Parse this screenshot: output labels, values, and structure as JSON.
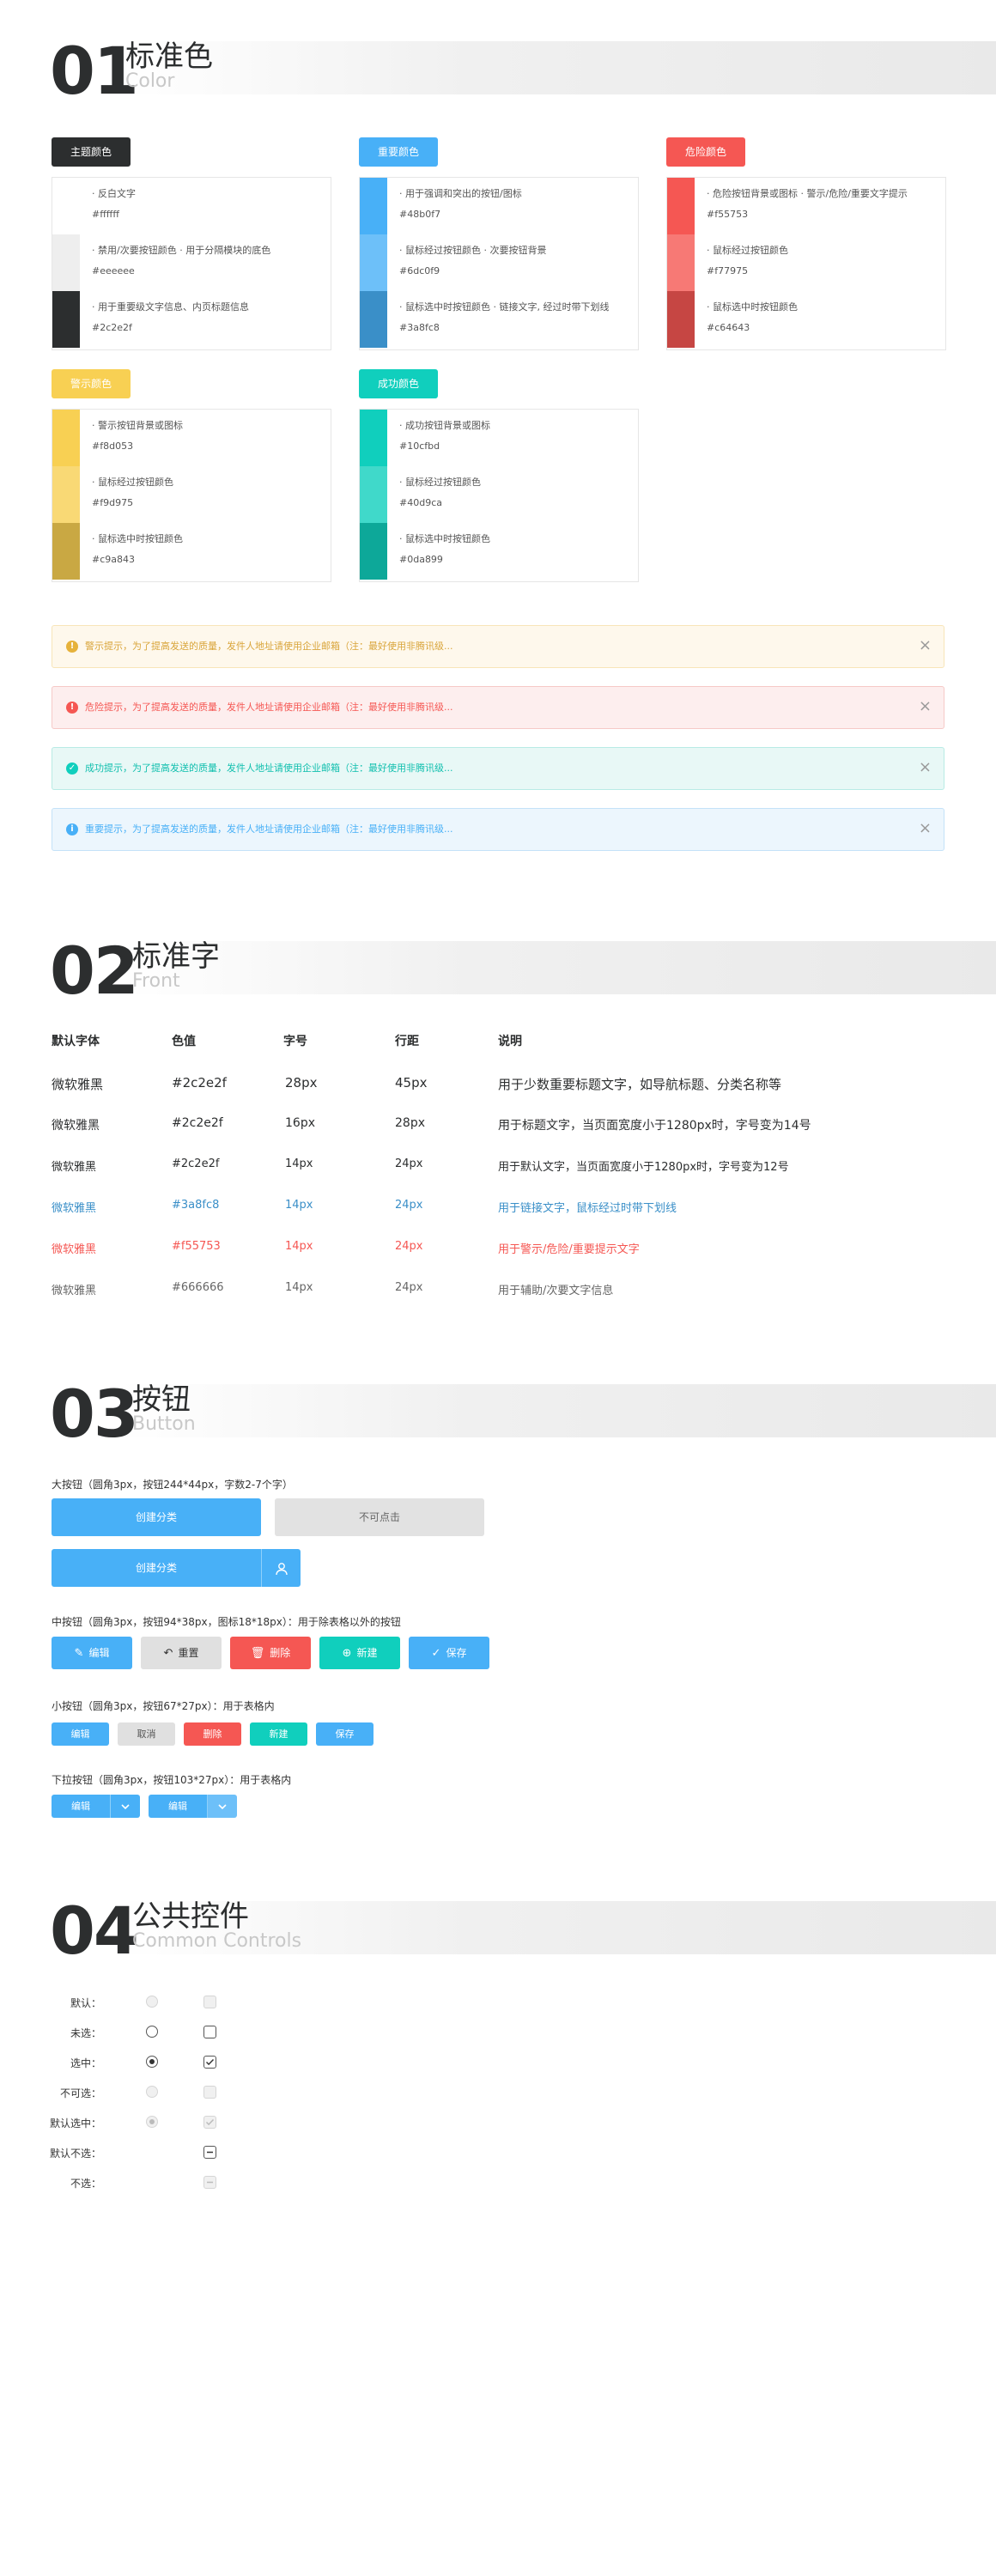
{
  "colors": {
    "accent": "#2c2e2f",
    "primary": "#48b0f7",
    "danger": "#f55753",
    "warning": "#f8d053",
    "success": "#10cfbd"
  },
  "section1": {
    "num": "01",
    "title": "标准色",
    "subtitle": "Color"
  },
  "swatches": [
    {
      "label": "主题颜色",
      "labelColor": "#2c2e2f",
      "rows": [
        {
          "color": "#ffffff",
          "desc": "· 反白文字",
          "hex": "#ffffff"
        },
        {
          "color": "#eeeeee",
          "desc": "· 禁用/次要按钮颜色 · 用于分隔模块的底色",
          "hex": "#eeeeee"
        },
        {
          "color": "#2c2e2f",
          "desc": "· 用于重要级文字信息、内页标题信息",
          "hex": "#2c2e2f"
        }
      ]
    },
    {
      "label": "重要颜色",
      "labelColor": "#48b0f7",
      "rows": [
        {
          "color": "#48b0f7",
          "desc": "· 用于强调和突出的按钮/图标",
          "hex": "#48b0f7"
        },
        {
          "color": "#6dc0f9",
          "desc": "· 鼠标经过按钮颜色 · 次要按钮背景",
          "hex": "#6dc0f9"
        },
        {
          "color": "#3a8fc8",
          "desc": "· 鼠标选中时按钮颜色 · 链接文字, 经过时带下划线",
          "hex": "#3a8fc8"
        }
      ]
    },
    {
      "label": "危险颜色",
      "labelColor": "#f55753",
      "rows": [
        {
          "color": "#f55753",
          "desc": "· 危险按钮背景或图标 · 警示/危险/重要文字提示",
          "hex": "#f55753"
        },
        {
          "color": "#f77975",
          "desc": "· 鼠标经过按钮颜色",
          "hex": "#f77975"
        },
        {
          "color": "#c64643",
          "desc": "· 鼠标选中时按钮颜色",
          "hex": "#c64643"
        }
      ]
    },
    {
      "label": "警示颜色",
      "labelColor": "#f8d053",
      "rows": [
        {
          "color": "#f8d053",
          "desc": "· 警示按钮背景或图标",
          "hex": "#f8d053"
        },
        {
          "color": "#f9d975",
          "desc": "· 鼠标经过按钮颜色",
          "hex": "#f9d975"
        },
        {
          "color": "#c9a843",
          "desc": "· 鼠标选中时按钮颜色",
          "hex": "#c9a843"
        }
      ]
    },
    {
      "label": "成功颜色",
      "labelColor": "#10cfbd",
      "rows": [
        {
          "color": "#10cfbd",
          "desc": "· 成功按钮背景或图标",
          "hex": "#10cfbd"
        },
        {
          "color": "#40d9ca",
          "desc": "· 鼠标经过按钮颜色",
          "hex": "#40d9ca"
        },
        {
          "color": "#0da899",
          "desc": "· 鼠标选中时按钮颜色",
          "hex": "#0da899"
        }
      ]
    }
  ],
  "alerts": [
    {
      "text": "警示提示，为了提高发送的质量，发件人地址请使用企业邮箱（注：最好使用非腾讯级...",
      "icon": "!",
      "close": "×",
      "bg": "#fef8ec",
      "border": "#f8e5b8",
      "color": "#d9a53a",
      "iconBg": "#e6b23b"
    },
    {
      "text": "危险提示，为了提高发送的质量，发件人地址请使用企业邮箱（注：最好使用非腾讯级...",
      "icon": "!",
      "close": "×",
      "bg": "#fdeeee",
      "border": "#f6c9c7",
      "color": "#f55753",
      "iconBg": "#f55753"
    },
    {
      "text": "成功提示，为了提高发送的质量，发件人地址请使用企业邮箱（注：最好使用非腾讯级...",
      "icon": "✓",
      "close": "×",
      "bg": "#e8f8f6",
      "border": "#b8ebe5",
      "color": "#10bfae",
      "iconBg": "#10cfbd"
    },
    {
      "text": "重要提示，为了提高发送的质量，发件人地址请使用企业邮箱（注：最好使用非腾讯级...",
      "icon": "i",
      "close": "×",
      "bg": "#ecf6fd",
      "border": "#c4e2f8",
      "color": "#48b0f7",
      "iconBg": "#48b0f7"
    }
  ],
  "section2": {
    "num": "02",
    "title": "标准字",
    "subtitle": "Front"
  },
  "fontTable": {
    "headers": [
      "默认字体",
      "色值",
      "字号",
      "行距",
      "说明"
    ],
    "rows": [
      {
        "font": "微软雅黑",
        "hex": "#2c2e2f",
        "size": "28px",
        "line": "45px",
        "desc": "用于少数重要标题文字，如导航标题、分类名称等",
        "color": "#2c2e2f",
        "fs": 15
      },
      {
        "font": "微软雅黑",
        "hex": "#2c2e2f",
        "size": "16px",
        "line": "28px",
        "desc": "用于标题文字，当页面宽度小于1280px时，字号变为14号",
        "color": "#2c2e2f",
        "fs": 14
      },
      {
        "font": "微软雅黑",
        "hex": "#2c2e2f",
        "size": "14px",
        "line": "24px",
        "desc": "用于默认文字，当页面宽度小于1280px时，字号变为12号",
        "color": "#2c2e2f",
        "fs": 13
      },
      {
        "font": "微软雅黑",
        "hex": "#3a8fc8",
        "size": "14px",
        "line": "24px",
        "desc": "用于链接文字，鼠标经过时带下划线",
        "color": "#3a8fc8",
        "fs": 13
      },
      {
        "font": "微软雅黑",
        "hex": "#f55753",
        "size": "14px",
        "line": "24px",
        "desc": "用于警示/危险/重要提示文字",
        "color": "#f55753",
        "fs": 13
      },
      {
        "font": "微软雅黑",
        "hex": "#666666",
        "size": "14px",
        "line": "24px",
        "desc": "用于辅助/次要文字信息",
        "color": "#666666",
        "fs": 13
      }
    ]
  },
  "section3": {
    "num": "03",
    "title": "按钮",
    "subtitle": "Button"
  },
  "buttons": {
    "largeLabel": "大按钮（圆角3px，按钮244*44px，字数2-7个字）",
    "create": "创建分类",
    "disabled": "不可点击",
    "createWithIcon": "创建分类",
    "mediumLabel": "中按钮（圆角3px，按钮94*38px，图标18*18px）：用于除表格以外的按钮",
    "medium": [
      {
        "label": "编辑",
        "bg": "#48b0f7",
        "color": "#ffffff",
        "icon": "edit-icon",
        "glyph": "✎"
      },
      {
        "label": "重置",
        "bg": "#e0e0e0",
        "color": "#333333",
        "icon": "undo-icon",
        "glyph": "↶"
      },
      {
        "label": "删除",
        "bg": "#f55753",
        "color": "#ffffff",
        "icon": "trash-icon",
        "glyph": "🗑"
      },
      {
        "label": "新建",
        "bg": "#10cfbd",
        "color": "#ffffff",
        "icon": "plus-circle-icon",
        "glyph": "⊕"
      },
      {
        "label": "保存",
        "bg": "#48b0f7",
        "color": "#ffffff",
        "icon": "check-circle-icon",
        "glyph": "✓"
      }
    ],
    "smallLabel": "小按钮（圆角3px，按钮67*27px）：用于表格内",
    "small": [
      {
        "label": "编辑",
        "bg": "#48b0f7",
        "color": "#ffffff"
      },
      {
        "label": "取消",
        "bg": "#e0e0e0",
        "color": "#555555"
      },
      {
        "label": "删除",
        "bg": "#f55753",
        "color": "#ffffff"
      },
      {
        "label": "新建",
        "bg": "#10cfbd",
        "color": "#ffffff"
      },
      {
        "label": "保存",
        "bg": "#48b0f7",
        "color": "#ffffff"
      }
    ],
    "dropLabel": "下拉按钮（圆角3px，按钮103*27px）：用于表格内",
    "drop": [
      {
        "label": "编辑"
      },
      {
        "label": "编辑"
      }
    ]
  },
  "section4": {
    "num": "04",
    "title": "公共控件",
    "subtitle": "Common Controls"
  },
  "controls": [
    {
      "label": "默认：",
      "radio": "disabled",
      "check": "disabled"
    },
    {
      "label": "未选：",
      "radio": "unchecked",
      "check": "unchecked"
    },
    {
      "label": "选中：",
      "radio": "checked",
      "check": "checked"
    },
    {
      "label": "不可选：",
      "radio": "disabled",
      "check": "disabled"
    },
    {
      "label": "默认选中：",
      "radio": "disabled-checked",
      "check": "disabled-checked"
    },
    {
      "label": "默认不选：",
      "radio": "",
      "check": "indeterminate"
    },
    {
      "label": "不选：",
      "radio": "",
      "check": "disabled-indeterminate"
    }
  ]
}
